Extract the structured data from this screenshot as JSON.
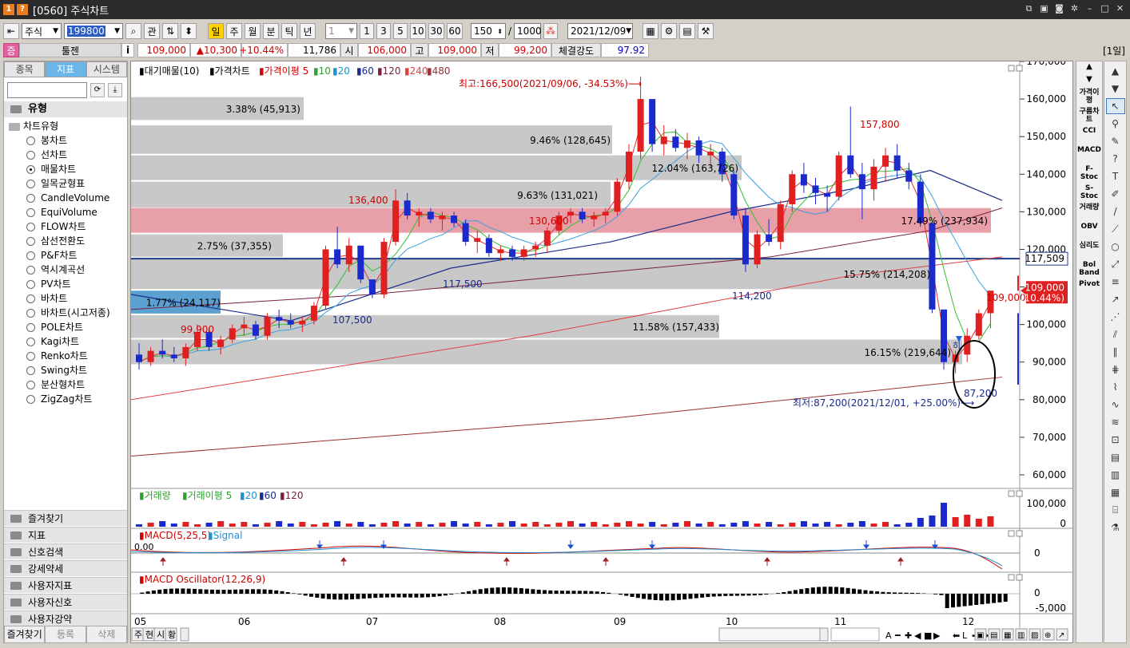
{
  "window": {
    "title": "[0560] 주식차트",
    "num": "1",
    "q": "?"
  },
  "toolbar": {
    "market": "주식",
    "code": "199800",
    "period_jp": "일",
    "periods": [
      "주",
      "월",
      "분",
      "틱",
      "년"
    ],
    "interval": "1",
    "intervals": [
      "1",
      "3",
      "5",
      "10",
      "30",
      "60"
    ],
    "count": "150",
    "total": "1000",
    "date": "2021/12/09",
    "opt": "관"
  },
  "info": {
    "tag": "증",
    "name": "툴젠",
    "i": "i",
    "price": "109,000",
    "change": "▲10,300",
    "rate": "+10.44%",
    "volume": "11,786",
    "open_lbl": "시",
    "open": "106,000",
    "high_lbl": "고",
    "high": "109,000",
    "low_lbl": "저",
    "low": "99,200",
    "strength_lbl": "체결강도",
    "strength": "97.92",
    "period_tag": "[1일]"
  },
  "sidebar": {
    "tabs": [
      "종목",
      "지표",
      "시스템"
    ],
    "header": "유형",
    "root": "차트유형",
    "items": [
      "봉차트",
      "선차트",
      "매물차트",
      "일목균형표",
      "CandleVolume",
      "EquiVolume",
      "FLOW차트",
      "삼선전환도",
      "P&F차트",
      "역시계곡선",
      "PV차트",
      "바차트",
      "바차트(시고저종)",
      "POLE차트",
      "Kagi차트",
      "Renko차트",
      "Swing차트",
      "분산형차트",
      "ZigZag차트"
    ],
    "selected": 2,
    "bottom": [
      "즐겨찾기",
      "지표",
      "신호검색",
      "강세약세",
      "사용자지표",
      "사용자신호",
      "사용자강약"
    ],
    "foot": [
      "즐겨찾기",
      "등록",
      "삭제"
    ]
  },
  "chart": {
    "legend": {
      "a": "대기매물(10)",
      "b": "가격차트",
      "c": "가격이평 5",
      "m10": "10",
      "m20": "20",
      "m60": "60",
      "m120": "120",
      "m240": "240",
      "m480": "480"
    },
    "max_label": "최고:166,500(2021/09/06, -34.53%)⟶",
    "min_label": "최저:87,200(2021/12/01, +25.00%)⟶",
    "yticks": [
      "170,000",
      "160,000",
      "150,000",
      "140,000",
      "130,000",
      "120,000",
      "110,000",
      "100,000",
      "90,000",
      "80,000",
      "70,000",
      "60,000"
    ],
    "last_price": "109,000",
    "last_rate": "(10.44%)",
    "hline_val": "117,509",
    "peaks": [
      "136,400",
      "130,600",
      "99,900",
      "107,500",
      "117,500",
      "114,200",
      "157,800",
      "109,000",
      "87,200"
    ],
    "bands": [
      "3.38% (45,913)",
      "9.46% (128,645)",
      "12.04% (163,726)",
      "9.63% (131,021)",
      "17.49% (237,934)",
      "2.75% (37,355)",
      "15.75% (214,208)",
      "1.77% (24,117)",
      "11.58% (157,433)",
      "16.15% (219,644)"
    ],
    "volume_legend": {
      "a": "거래량",
      "b": "거래이평 5",
      "c": "20",
      "d": "60",
      "e": "120"
    },
    "volume_ticks": [
      "100,000",
      "0"
    ],
    "macd_legend": {
      "a": "MACD(5,25,5)",
      "b": "Signal"
    },
    "macd_val": "0.00",
    "macd_tick": "0",
    "osc_legend": "MACD Oscillator(12,26,9)",
    "osc_ticks": [
      "0",
      "-5,000"
    ],
    "xticks": [
      "05",
      "06",
      "07",
      "08",
      "09",
      "10",
      "11",
      "12"
    ],
    "bottom_tabs": [
      "주",
      "현",
      "시",
      "황"
    ],
    "annot": "히"
  },
  "right_tools": [
    "가격이평",
    "구름차트",
    "CCI",
    "MACD",
    "F-Stoc",
    "S-Stoc",
    "거래량",
    "OBV",
    "심리도",
    "Bol Band",
    "Pivot"
  ],
  "chart_data": {
    "type": "candlestick",
    "x": [
      "05",
      "06",
      "07",
      "08",
      "09",
      "10",
      "11",
      "12"
    ],
    "ylim": [
      60000,
      170000
    ],
    "candles": [
      [
        92,
        95,
        88,
        90
      ],
      [
        90,
        94,
        89,
        93
      ],
      [
        93,
        96,
        91,
        92
      ],
      [
        92,
        94,
        90,
        91
      ],
      [
        91,
        95,
        89,
        94
      ],
      [
        94,
        100,
        93,
        98
      ],
      [
        98,
        99,
        93,
        94
      ],
      [
        94,
        97,
        92,
        96
      ],
      [
        96,
        100,
        95,
        99
      ],
      [
        99,
        102,
        97,
        100
      ],
      [
        100,
        101,
        96,
        97
      ],
      [
        97,
        103,
        96,
        102
      ],
      [
        102,
        104,
        99,
        101
      ],
      [
        101,
        103,
        99,
        100
      ],
      [
        100,
        102,
        98,
        101
      ],
      [
        101,
        106,
        100,
        105
      ],
      [
        105,
        121,
        104,
        120
      ],
      [
        120,
        126,
        115,
        116
      ],
      [
        116,
        123,
        114,
        121
      ],
      [
        121,
        119,
        111,
        112
      ],
      [
        112,
        112,
        107,
        108
      ],
      [
        108,
        123,
        107,
        122
      ],
      [
        122,
        136,
        121,
        133
      ],
      [
        133,
        135,
        128,
        129
      ],
      [
        129,
        131,
        126,
        130
      ],
      [
        130,
        131,
        127,
        128
      ],
      [
        128,
        130,
        125,
        129
      ],
      [
        129,
        130,
        126,
        127
      ],
      [
        127,
        128,
        121,
        122
      ],
      [
        122,
        125,
        119,
        123
      ],
      [
        123,
        124,
        118,
        119
      ],
      [
        119,
        121,
        117,
        120
      ],
      [
        120,
        121,
        117,
        118
      ],
      [
        118,
        121,
        117,
        120
      ],
      [
        120,
        122,
        118,
        121
      ],
      [
        121,
        126,
        119,
        125
      ],
      [
        125,
        130,
        124,
        129
      ],
      [
        129,
        131,
        127,
        130
      ],
      [
        130,
        131,
        127,
        128
      ],
      [
        128,
        130,
        126,
        129
      ],
      [
        129,
        131,
        127,
        130
      ],
      [
        130,
        139,
        129,
        138
      ],
      [
        138,
        148,
        136,
        146
      ],
      [
        146,
        166,
        144,
        160
      ],
      [
        160,
        158,
        146,
        148
      ],
      [
        148,
        153,
        145,
        150
      ],
      [
        150,
        152,
        146,
        147
      ],
      [
        147,
        151,
        144,
        149
      ],
      [
        149,
        150,
        143,
        145
      ],
      [
        145,
        148,
        142,
        146
      ],
      [
        146,
        147,
        138,
        140
      ],
      [
        140,
        141,
        128,
        129
      ],
      [
        129,
        131,
        114,
        116
      ],
      [
        116,
        125,
        115,
        124
      ],
      [
        124,
        128,
        121,
        122
      ],
      [
        122,
        133,
        120,
        132
      ],
      [
        132,
        141,
        130,
        140
      ],
      [
        140,
        143,
        135,
        137
      ],
      [
        137,
        139,
        132,
        135
      ],
      [
        135,
        137,
        130,
        134
      ],
      [
        134,
        146,
        133,
        145
      ],
      [
        145,
        158,
        139,
        140
      ],
      [
        140,
        143,
        128,
        136
      ],
      [
        136,
        144,
        133,
        142
      ],
      [
        142,
        147,
        138,
        145
      ],
      [
        145,
        148,
        139,
        141
      ],
      [
        141,
        143,
        136,
        138
      ],
      [
        138,
        140,
        126,
        127
      ],
      [
        127,
        118,
        103,
        104
      ],
      [
        104,
        97,
        88,
        90
      ],
      [
        90,
        93,
        87,
        92
      ],
      [
        92,
        99,
        90,
        97
      ],
      [
        97,
        104,
        96,
        103
      ],
      [
        103,
        109,
        99,
        109
      ]
    ],
    "bands": [
      {
        "pct": 3.38,
        "vol": 45913
      },
      {
        "pct": 9.46,
        "vol": 128645
      },
      {
        "pct": 12.04,
        "vol": 163726
      },
      {
        "pct": 9.63,
        "vol": 131021
      },
      {
        "pct": 17.49,
        "vol": 237934
      },
      {
        "pct": 2.75,
        "vol": 37355
      },
      {
        "pct": 15.75,
        "vol": 214208
      },
      {
        "pct": 1.77,
        "vol": 24117
      },
      {
        "pct": 11.58,
        "vol": 157433
      },
      {
        "pct": 16.15,
        "vol": 219644
      }
    ],
    "hline": 117509,
    "max": {
      "value": 166500,
      "date": "2021/09/06"
    },
    "min": {
      "value": 87200,
      "date": "2021/12/01"
    }
  }
}
